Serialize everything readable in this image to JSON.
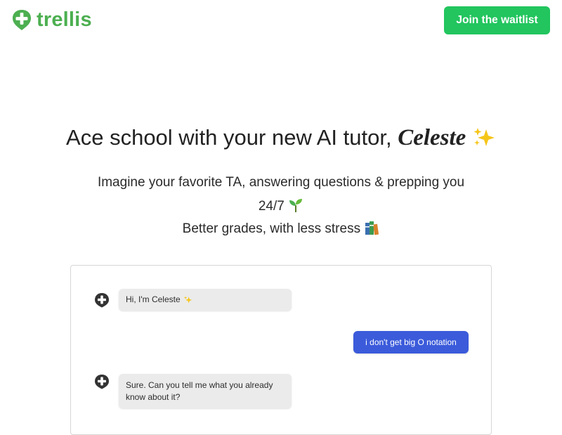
{
  "brand": {
    "name": "trellis",
    "color": "#4caf50",
    "icon": "trellis-logo-icon"
  },
  "header": {
    "cta_label": "Join the waitlist",
    "cta_color": "#22c55e"
  },
  "hero": {
    "title_prefix": "Ace school with your new AI tutor, ",
    "title_name": "Celeste",
    "title_emoji": "sparkles",
    "subtitle_line1": "Imagine your favorite TA, answering questions & prepping you",
    "subtitle_line2": "24/7",
    "subtitle_line2_emoji": "seedling",
    "subtitle_line3": "Better grades, with less stress",
    "subtitle_line3_emoji": "books"
  },
  "chat": {
    "messages": [
      {
        "sender": "bot",
        "text": "Hi, I'm Celeste",
        "emoji": "sparkles"
      },
      {
        "sender": "user",
        "text": "i don't get big O notation"
      },
      {
        "sender": "bot",
        "text": "Sure. Can you tell me what you already know about it?"
      }
    ],
    "user_bubble_color": "#3b5bdb",
    "bot_bubble_color": "#ebebeb"
  }
}
